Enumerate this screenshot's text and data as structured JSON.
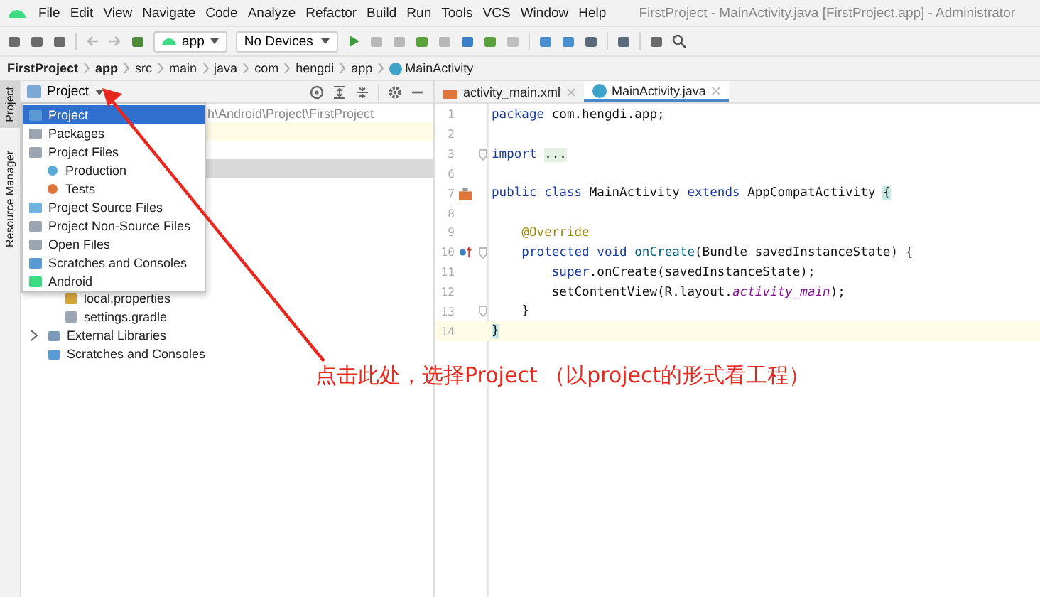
{
  "window": {
    "title": "FirstProject - MainActivity.java [FirstProject.app] - Administrator"
  },
  "menu": [
    "File",
    "Edit",
    "View",
    "Navigate",
    "Code",
    "Analyze",
    "Refactor",
    "Build",
    "Run",
    "Tools",
    "VCS",
    "Window",
    "Help"
  ],
  "toolbar": {
    "config": "app",
    "device": "No Devices"
  },
  "breadcrumb": [
    {
      "label": "FirstProject",
      "bold": true
    },
    {
      "label": "app",
      "bold": true
    },
    {
      "label": "src",
      "bold": false
    },
    {
      "label": "main",
      "bold": false
    },
    {
      "label": "java",
      "bold": false
    },
    {
      "label": "com",
      "bold": false
    },
    {
      "label": "hengdi",
      "bold": false
    },
    {
      "label": "app",
      "bold": false
    },
    {
      "label": "MainActivity",
      "bold": false,
      "kind": "class"
    }
  ],
  "side_tabs": [
    {
      "label": "Project",
      "selected": true
    },
    {
      "label": "Resource Manager",
      "selected": false
    }
  ],
  "project_panel": {
    "view": "Project",
    "path_fragment": "h\\Android\\Project\\FirstProject",
    "tree": [
      {
        "children": [
          {
            "label": "local.properties",
            "kind": "properties"
          },
          {
            "label": "settings.gradle",
            "kind": "gradle"
          }
        ]
      },
      {
        "label": "External Libraries",
        "kind": "library",
        "expanded": false
      },
      {
        "label": "Scratches and Consoles",
        "kind": "scratch"
      }
    ]
  },
  "view_menu": [
    {
      "label": "Project",
      "kind": "project",
      "selected": true
    },
    {
      "label": "Packages",
      "kind": "folder",
      "selected": false
    },
    {
      "label": "Project Files",
      "kind": "folder",
      "selected": false,
      "children": [
        {
          "label": "Production",
          "kind": "production",
          "selected": false
        },
        {
          "label": "Tests",
          "kind": "tests",
          "selected": false
        }
      ]
    },
    {
      "label": "Project Source Files",
      "kind": "source",
      "selected": false
    },
    {
      "label": "Project Non-Source Files",
      "kind": "folder",
      "selected": false
    },
    {
      "label": "Open Files",
      "kind": "file",
      "selected": false
    },
    {
      "label": "Scratches and Consoles",
      "kind": "scratch",
      "selected": false
    },
    {
      "label": "Android",
      "kind": "android",
      "selected": false
    }
  ],
  "editor_tabs": [
    {
      "label": "activity_main.xml",
      "kind": "xml",
      "selected": false
    },
    {
      "label": "MainActivity.java",
      "kind": "class",
      "selected": true
    }
  ],
  "code": [
    {
      "number": "1",
      "kind": "plain",
      "tokens": [
        {
          "kind": "keyword",
          "text": "package"
        },
        {
          "kind": "plain",
          "text": " com.hengdi.app;"
        }
      ]
    },
    {
      "number": "2",
      "kind": "plain"
    },
    {
      "number": "3",
      "kind": "plain",
      "fold": true,
      "tokens": [
        {
          "kind": "keyword",
          "text": "import "
        },
        {
          "kind": "folded",
          "text": "..."
        }
      ]
    },
    {
      "number": "6",
      "kind": "plain"
    },
    {
      "number": "7",
      "kind": "layout-link",
      "tokens": [
        {
          "kind": "keyword",
          "text": "public class"
        },
        {
          "kind": "plain",
          "text": " MainActivity "
        },
        {
          "kind": "keyword",
          "text": "extends"
        },
        {
          "kind": "plain",
          "text": " AppCompatActivity "
        },
        {
          "kind": "brace",
          "text": "{"
        }
      ]
    },
    {
      "number": "8",
      "kind": "plain"
    },
    {
      "number": "9",
      "kind": "plain",
      "tokens": [
        {
          "kind": "annotation",
          "text": "    @Override"
        }
      ]
    },
    {
      "number": "10",
      "kind": "override",
      "fold": true,
      "tokens": [
        {
          "kind": "keyword",
          "text": "    protected void "
        },
        {
          "kind": "method",
          "text": "onCreate"
        },
        {
          "kind": "plain",
          "text": "(Bundle savedInstanceState) {"
        }
      ]
    },
    {
      "number": "11",
      "kind": "plain",
      "tokens": [
        {
          "kind": "keyword",
          "text": "        super"
        },
        {
          "kind": "plain",
          "text": ".onCreate(savedInstanceState);"
        }
      ]
    },
    {
      "number": "12",
      "kind": "plain",
      "tokens": [
        {
          "kind": "plain",
          "text": "        setContentView(R.layout."
        },
        {
          "kind": "field",
          "text": "activity_main"
        },
        {
          "kind": "plain",
          "text": ");"
        }
      ]
    },
    {
      "number": "13",
      "kind": "plain",
      "fold": true,
      "tokens": [
        {
          "kind": "plain",
          "text": "    }"
        }
      ]
    },
    {
      "number": "14",
      "kind": "plain",
      "current": true,
      "tokens": [
        {
          "kind": "brace",
          "text": "}"
        }
      ]
    }
  ],
  "annotation": {
    "text": "点击此处，选择Project （以project的形式看工程）"
  }
}
